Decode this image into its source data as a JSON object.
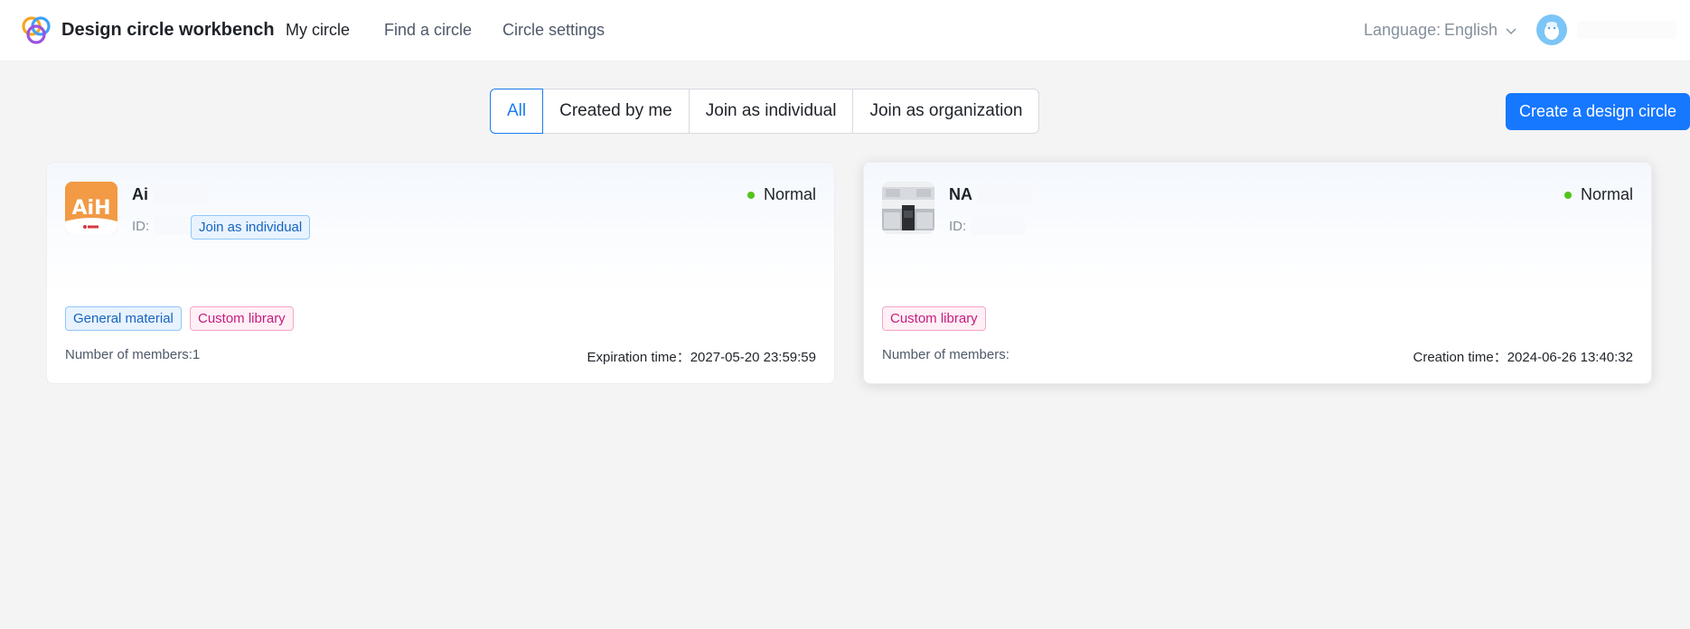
{
  "header": {
    "app_title": "Design circle workbench",
    "nav": [
      {
        "label": "My circle",
        "active": true
      },
      {
        "label": "Find a circle",
        "active": false
      },
      {
        "label": "Circle settings",
        "active": false
      }
    ],
    "language_label": "Language:",
    "language_value": "English",
    "avatar_icon": "user-avatar-icon"
  },
  "filters": {
    "tabs": [
      {
        "label": "All",
        "active": true
      },
      {
        "label": "Created by me",
        "active": false
      },
      {
        "label": "Join as individual",
        "active": false
      },
      {
        "label": "Join as organization",
        "active": false
      }
    ],
    "create_button": "Create a design circle"
  },
  "cards": [
    {
      "name": "Ai",
      "id_label": "ID:",
      "status": "Normal",
      "status_color": "#52c41a",
      "join_tag": "Join as individual",
      "tags": [
        "General material",
        "Custom library"
      ],
      "members_label": "Number of members:",
      "members_value": "1",
      "time_label": "Expiration time：",
      "time_value": "2027-05-20 23:59:59",
      "logo_text": "AiH"
    },
    {
      "name": "NA",
      "id_label": "ID:",
      "status": "Normal",
      "status_color": "#52c41a",
      "tags": [
        "Custom library"
      ],
      "members_label": "Number of members:",
      "members_value": "",
      "time_label": "Creation time：",
      "time_value": "2024-06-26 13:40:32"
    }
  ],
  "colors": {
    "primary": "#1677ff",
    "status_normal": "#52c41a",
    "tag_blue": "#1664c0",
    "tag_pink": "#c41d7f"
  }
}
